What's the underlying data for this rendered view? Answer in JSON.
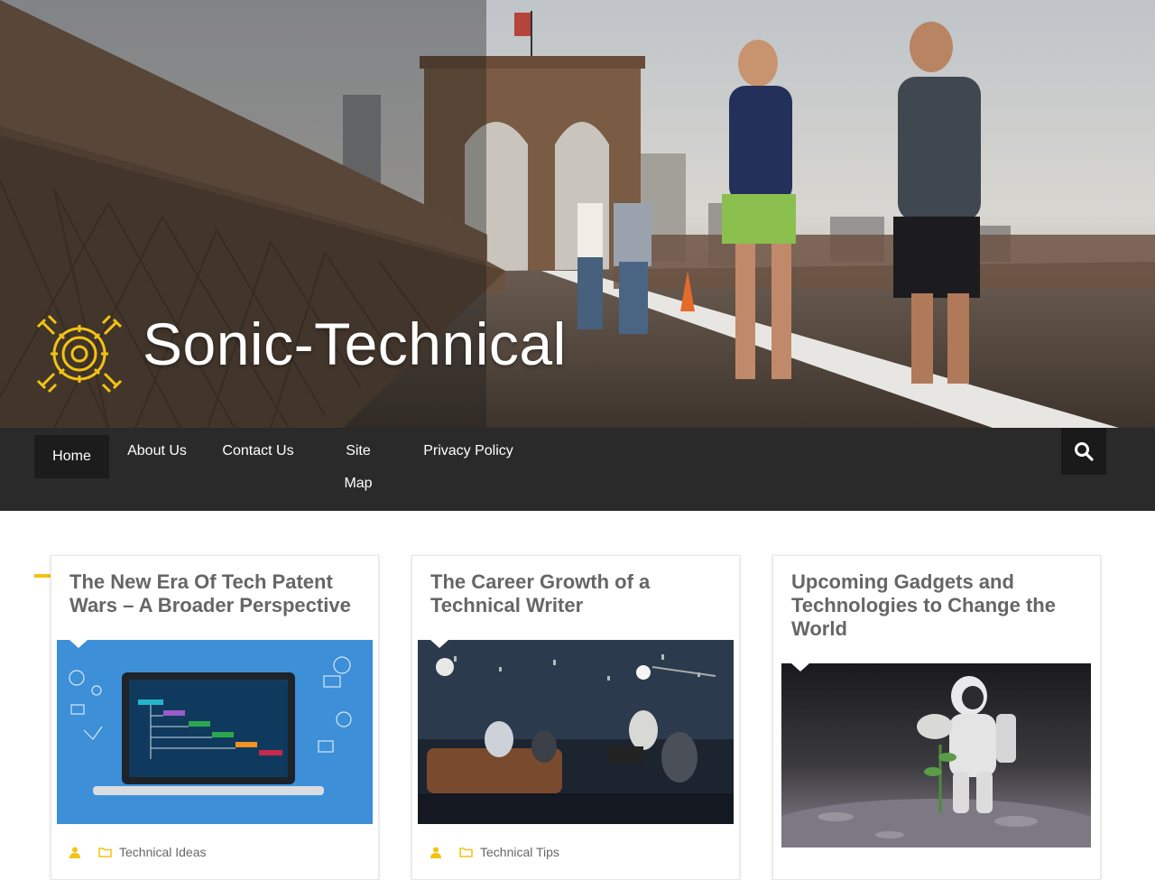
{
  "site": {
    "title": "Sonic-Technical",
    "accent_color": "#f2c313"
  },
  "nav": {
    "items": [
      {
        "label": "Home",
        "active": true
      },
      {
        "label": "About Us"
      },
      {
        "label": "Contact Us"
      },
      {
        "label_line1": "Site",
        "label_line2": "Map"
      },
      {
        "label": "Privacy Policy"
      }
    ],
    "search_icon": "search-icon"
  },
  "posts": [
    {
      "title": "The New Era Of Tech Patent Wars – A Broader Perspective",
      "category": "Technical Ideas",
      "image": "laptop-flowchart-illustration"
    },
    {
      "title": "The Career Growth of a Technical Writer",
      "category": "Technical Tips",
      "image": "film-crew-studio-photo"
    },
    {
      "title": "Upcoming Gadgets and Technologies to Change the World",
      "category": "",
      "image": "astronaut-plant-moon-photo"
    }
  ]
}
